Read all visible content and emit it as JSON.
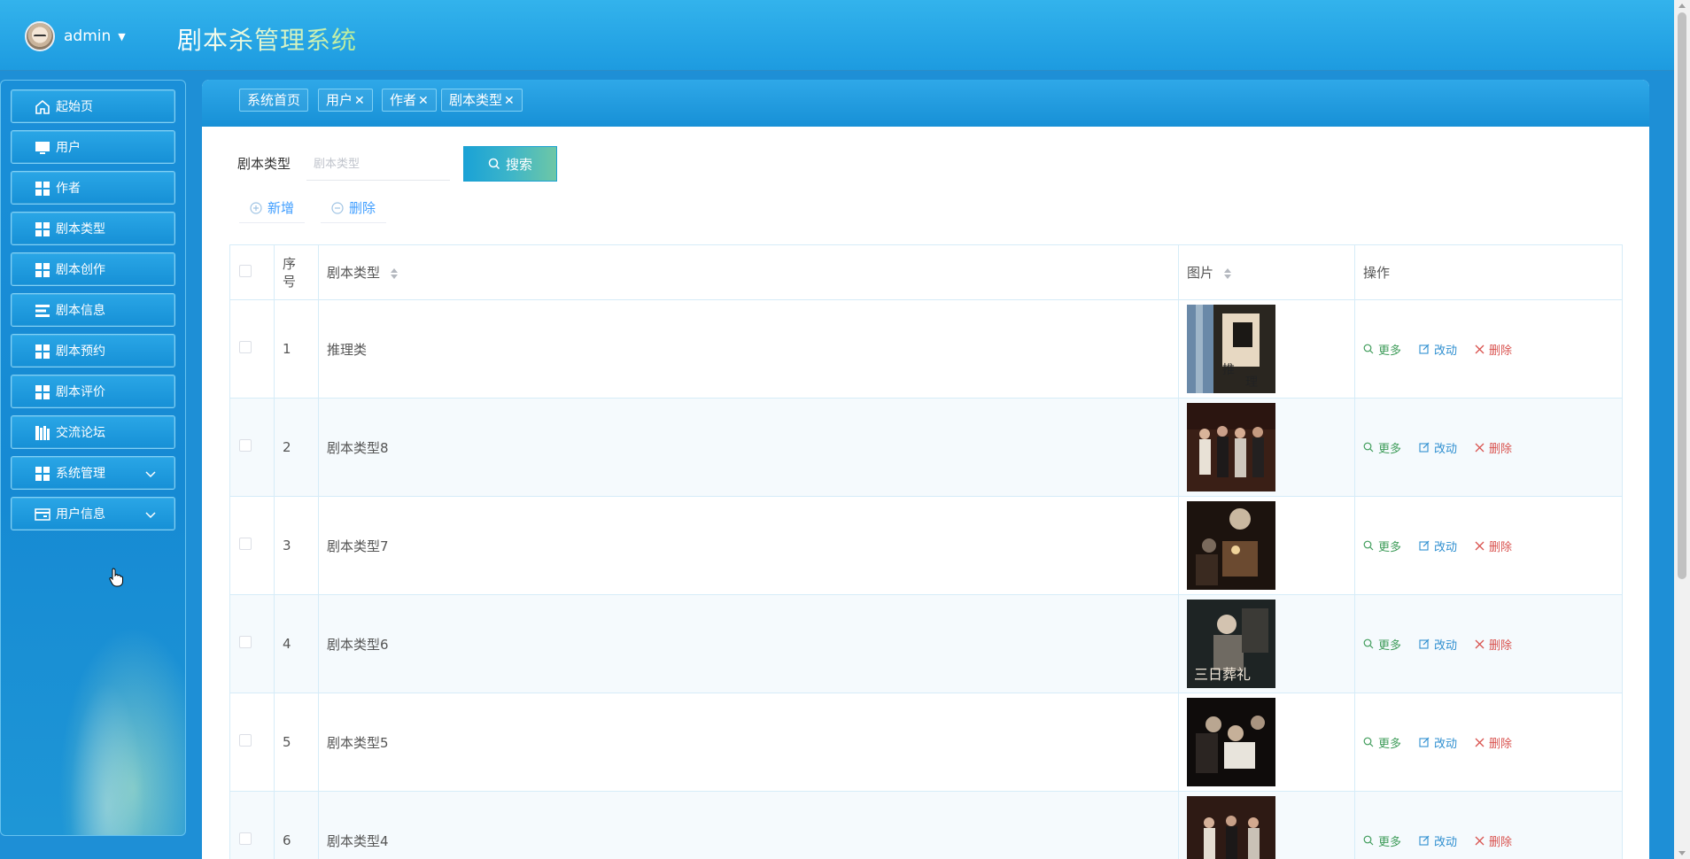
{
  "header": {
    "username": "admin",
    "app_title": "剧本杀管理系统"
  },
  "sidebar": {
    "items": [
      {
        "label": "起始页",
        "icon": "home-icon"
      },
      {
        "label": "用户",
        "icon": "monitor-icon"
      },
      {
        "label": "作者",
        "icon": "grid-icon"
      },
      {
        "label": "剧本类型",
        "icon": "grid-icon"
      },
      {
        "label": "剧本创作",
        "icon": "grid-icon"
      },
      {
        "label": "剧本信息",
        "icon": "list-icon"
      },
      {
        "label": "剧本预约",
        "icon": "grid-icon"
      },
      {
        "label": "剧本评价",
        "icon": "grid-icon"
      },
      {
        "label": "交流论坛",
        "icon": "books-icon"
      },
      {
        "label": "系统管理",
        "icon": "grid-icon",
        "expandable": true
      },
      {
        "label": "用户信息",
        "icon": "card-icon",
        "expandable": true
      }
    ]
  },
  "tabs": [
    {
      "label": "系统首页",
      "closable": false
    },
    {
      "label": "用户",
      "closable": true
    },
    {
      "label": "作者",
      "closable": true
    },
    {
      "label": "剧本类型",
      "closable": true
    }
  ],
  "search": {
    "label": "剧本类型",
    "placeholder": "剧本类型",
    "value": "",
    "button_label": "搜索"
  },
  "actions": {
    "add_label": "新增",
    "delete_label": "删除"
  },
  "table": {
    "columns": {
      "index": "序号",
      "type": "剧本类型",
      "image": "图片",
      "ops": "操作"
    },
    "ops": {
      "more": "更多",
      "edit": "改动",
      "delete": "删除"
    },
    "rows": [
      {
        "index": "1",
        "type": "推理类",
        "image": "img-reasoning"
      },
      {
        "index": "2",
        "type": "剧本类型8",
        "image": "img-group-1"
      },
      {
        "index": "3",
        "type": "剧本类型7",
        "image": "img-dark-room"
      },
      {
        "index": "4",
        "type": "剧本类型6",
        "image": "img-poster"
      },
      {
        "index": "5",
        "type": "剧本类型5",
        "image": "img-night"
      },
      {
        "index": "6",
        "type": "剧本类型4",
        "image": "img-group-2"
      }
    ]
  },
  "colors": {
    "header_bg": "#1d9be0",
    "sidebar_bg": "#168ad3",
    "accent": "#409eff",
    "op_more": "#3f9c5a",
    "op_edit": "#2f8fd0",
    "op_delete": "#d9534f"
  }
}
